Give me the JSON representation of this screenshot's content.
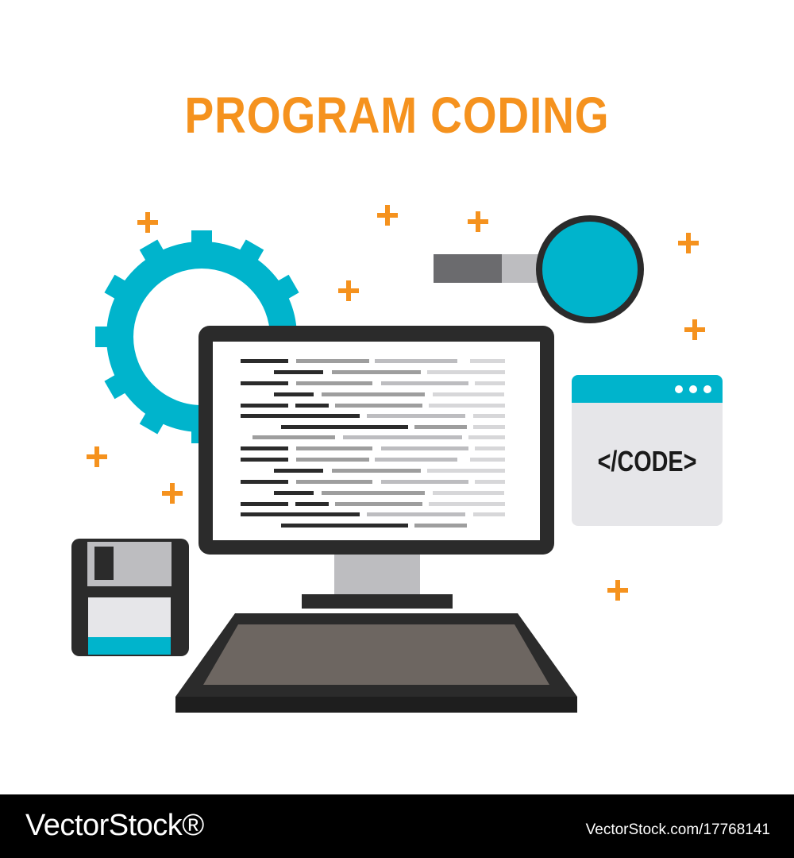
{
  "title": "PROGRAM CODING",
  "code_window": {
    "label": "</CODE>"
  },
  "footer": {
    "logo": "VectorStock®",
    "image_id": "VectorStock.com/17768141"
  },
  "icons": [
    "gear-icon",
    "magnifier-icon",
    "monitor-icon",
    "keyboard-icon",
    "floppy-disk-icon",
    "code-window-icon",
    "plus-sparkle-icon"
  ],
  "colors": {
    "accent_orange": "#f5921e",
    "accent_cyan": "#00b4cc",
    "dark": "#2b2b2b",
    "keyboard": "#6d6661",
    "light_gray": "#e6e6e9"
  }
}
